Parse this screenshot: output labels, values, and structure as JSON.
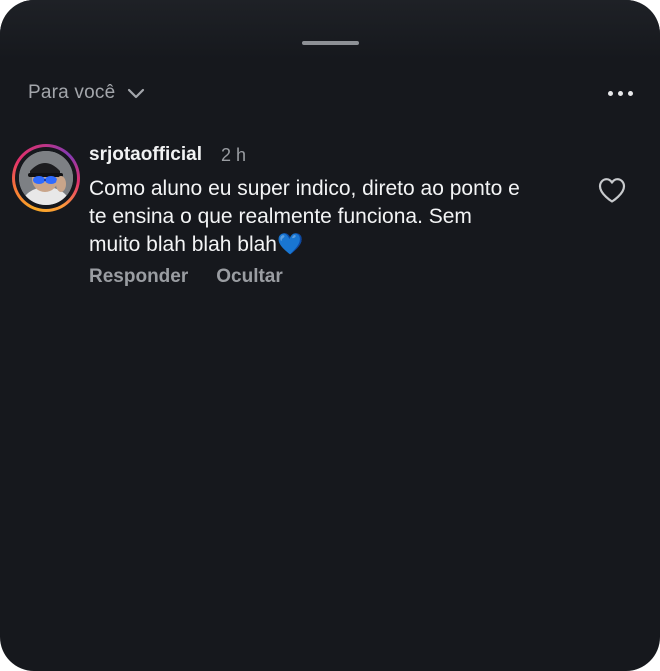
{
  "sheet": {
    "filter_label": "Para você",
    "more_icon": "more-horizontal-icon"
  },
  "comment": {
    "username": "srjotaofficial",
    "time": "2 h",
    "text": "Como aluno eu super indico, direto ao ponto e te ensina o que realmente funciona. Sem muito blah blah blah💙",
    "reply_label": "Responder",
    "hide_label": "Ocultar",
    "like_icon": "heart-outline-icon"
  },
  "colors": {
    "background": "#16181d",
    "primary_text": "#f3f4f5",
    "secondary_text": "#9a9da2",
    "story_ring": [
      "#f9a825",
      "#e1306c",
      "#833ab4"
    ]
  }
}
